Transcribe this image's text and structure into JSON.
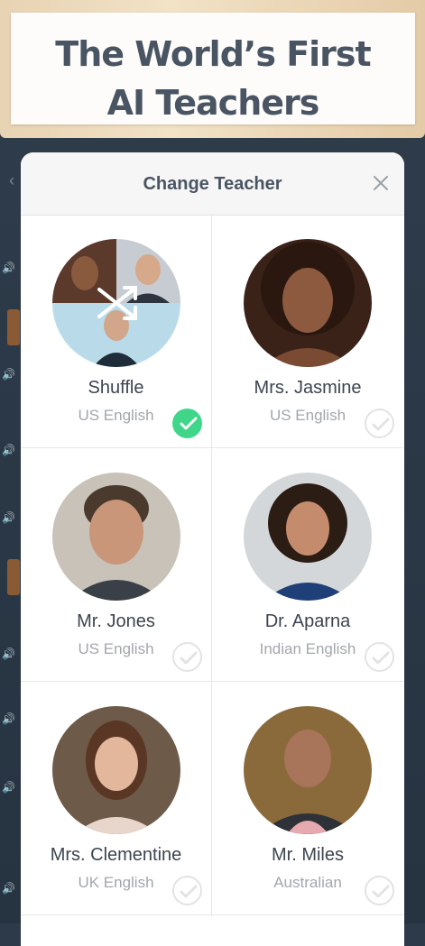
{
  "banner": {
    "line1": "The World’s First",
    "line2": "AI Teachers"
  },
  "modal": {
    "title": "Change Teacher",
    "close_icon": "close-icon"
  },
  "teachers": [
    {
      "name": "Shuffle",
      "language": "US English",
      "selected": true,
      "avatar_icon": "shuffle-icon"
    },
    {
      "name": "Mrs. Jasmine",
      "language": "US English",
      "selected": false
    },
    {
      "name": "Mr. Jones",
      "language": "US English",
      "selected": false
    },
    {
      "name": "Dr. Aparna",
      "language": "Indian English",
      "selected": false
    },
    {
      "name": "Mrs. Clementine",
      "language": "UK English",
      "selected": false
    },
    {
      "name": "Mr. Miles",
      "language": "Australian",
      "selected": false
    }
  ],
  "colors": {
    "selected_check": "#3fd68a",
    "title_text": "#4a5563",
    "subtitle_text": "#a2a7ad"
  }
}
